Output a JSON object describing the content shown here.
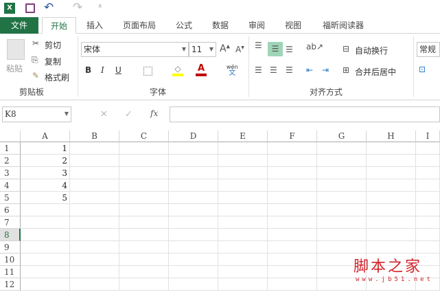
{
  "qat": {
    "app_icon": "excel-icon",
    "save": "save-icon",
    "undo": "undo-icon",
    "redo": "redo-icon",
    "customize": "customize-qat-icon"
  },
  "tabs": [
    {
      "label": "文件"
    },
    {
      "label": "开始"
    },
    {
      "label": "插入"
    },
    {
      "label": "页面布局"
    },
    {
      "label": "公式"
    },
    {
      "label": "数据"
    },
    {
      "label": "审阅"
    },
    {
      "label": "视图"
    },
    {
      "label": "福昕阅读器"
    }
  ],
  "clipboard": {
    "paste": "粘贴",
    "cut": "剪切",
    "copy": "复制",
    "format_painter": "格式刷",
    "label": "剪贴板"
  },
  "font": {
    "name": "宋体",
    "size": "11",
    "label": "字体",
    "bold": "B",
    "italic": "I",
    "underline": "U",
    "phonetic_top": "wén",
    "phonetic_bottom": "文"
  },
  "alignment": {
    "wrap": "自动换行",
    "merge": "合并后居中",
    "label": "对齐方式"
  },
  "number": {
    "format": "常规"
  },
  "formula_bar": {
    "name_box": "K8",
    "fx": "fx",
    "value": ""
  },
  "columns": [
    "A",
    "B",
    "C",
    "D",
    "E",
    "F",
    "G",
    "H",
    "I"
  ],
  "rows": [
    "1",
    "2",
    "3",
    "4",
    "5",
    "6",
    "7",
    "8",
    "9",
    "10",
    "11",
    "12"
  ],
  "cells": {
    "A": [
      "1",
      "2",
      "3",
      "4",
      "5",
      "",
      "",
      "",
      "",
      "",
      "",
      ""
    ]
  },
  "active_row": "8",
  "watermark": {
    "title": "脚本之家",
    "url": "www.jb51.net"
  },
  "colors": {
    "accent": "#217346",
    "highlight": "#ffff00",
    "font_color": "#c00000"
  }
}
